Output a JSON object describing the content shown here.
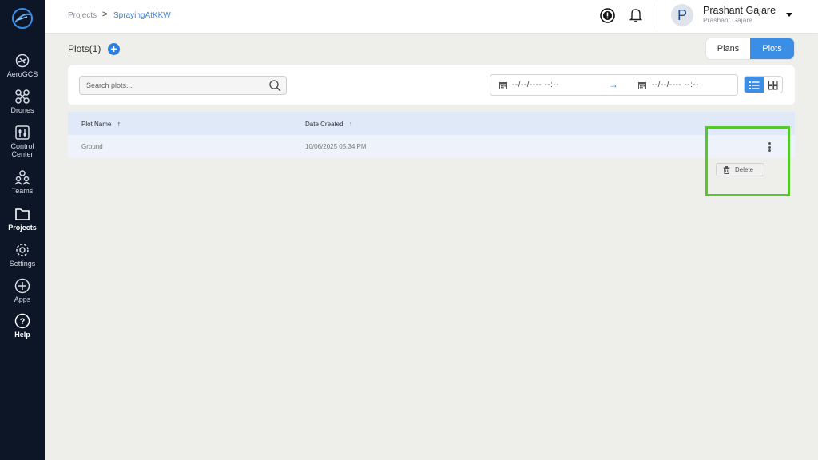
{
  "sidebar": {
    "items": [
      {
        "label": "AeroGCS",
        "icon": "drone-controller-icon"
      },
      {
        "label": "Drones",
        "icon": "quadcopter-icon"
      },
      {
        "label": "Control Center",
        "icon": "sliders-icon"
      },
      {
        "label": "Teams",
        "icon": "team-icon"
      },
      {
        "label": "Projects",
        "icon": "folder-icon",
        "active": true
      },
      {
        "label": "Settings",
        "icon": "gear-icon"
      },
      {
        "label": "Apps",
        "icon": "plus-circle-icon"
      },
      {
        "label": "Help",
        "icon": "help-circle-icon"
      }
    ]
  },
  "breadcrumb": {
    "root": "Projects",
    "separator": ">",
    "current": "SprayingAtKKW"
  },
  "user": {
    "initial": "P",
    "name": "Prashant Gajare",
    "subtitle": "Prashant Gajare"
  },
  "header": {
    "title": "Plots(1)",
    "add": "+"
  },
  "toggle": {
    "plans": "Plans",
    "plots": "Plots",
    "active": "Plots"
  },
  "search": {
    "placeholder": "Search plots..."
  },
  "date_range": {
    "from": "--/--/---- --:--",
    "arrow": "→",
    "to": "--/--/---- --:--"
  },
  "table": {
    "columns": [
      "Plot Name",
      "Date Created"
    ],
    "sort_indicator": "↑",
    "rows": [
      {
        "name": "Ground",
        "date": "10/06/2025 05:34 PM"
      }
    ]
  },
  "row_menu": {
    "delete_label": "Delete"
  },
  "colors": {
    "accent": "#3a8ee6",
    "sidebar": "#0c1627",
    "highlight": "#56c72c"
  }
}
